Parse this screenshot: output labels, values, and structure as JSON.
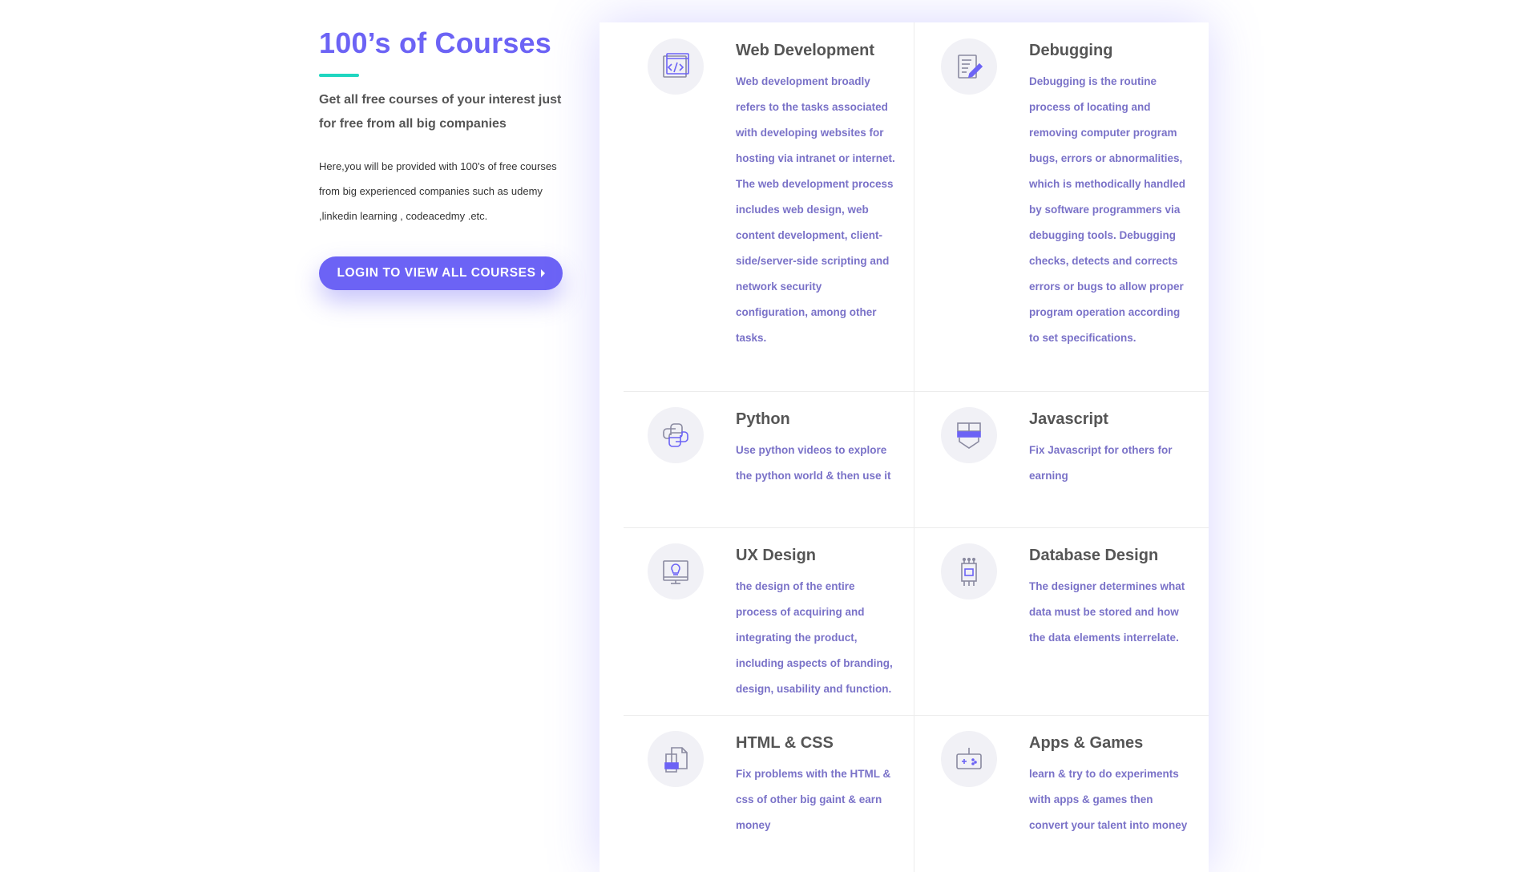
{
  "intro": {
    "title": "100’s of Courses",
    "subtitle": "Get all free courses of your interest just for free from all big companies",
    "paragraph": "Here,you will be provided with 100's of free courses from big experienced companies such as udemy ,linkedin learning , codeacedmy .etc.",
    "cta_label": "LOGIN TO VIEW ALL COURSES"
  },
  "courses": [
    {
      "icon": "code-window-icon",
      "title": "Web Development",
      "desc": "Web development broadly refers to the tasks associated with developing websites for hosting via intranet or internet. The web development process includes web design, web content development, client-side/server-side scripting and network security configuration, among other tasks."
    },
    {
      "icon": "document-pen-icon",
      "title": "Debugging",
      "desc": "Debugging is the routine process of locating and removing computer program bugs, errors or abnormalities, which is methodically handled by software programmers via debugging tools. Debugging checks, detects and corrects errors or bugs to allow proper program operation according to set specifications."
    },
    {
      "icon": "python-icon",
      "title": "Python",
      "desc": "Use python videos to explore the python world & then use it"
    },
    {
      "icon": "shield-icon",
      "title": "Javascript",
      "desc": "Fix Javascript for others for earning"
    },
    {
      "icon": "lightbulb-monitor-icon",
      "title": "UX Design",
      "desc": "the design of the entire process of acquiring and integrating the product, including aspects of branding, design, usability and function."
    },
    {
      "icon": "chip-icon",
      "title": "Database Design",
      "desc": "The designer determines what data must be stored and how the data elements interrelate."
    },
    {
      "icon": "files-icon",
      "title": "HTML & CSS",
      "desc": "Fix problems with the HTML & css of other big gaint & earn money"
    },
    {
      "icon": "gamepad-icon",
      "title": "Apps & Games",
      "desc": "learn & try to do experiments with apps & games then convert your talent into money"
    }
  ],
  "colors": {
    "accent": "#6c63f5",
    "teal": "#1fd6c0",
    "desc": "#7a72c8",
    "heading": "#555555"
  }
}
